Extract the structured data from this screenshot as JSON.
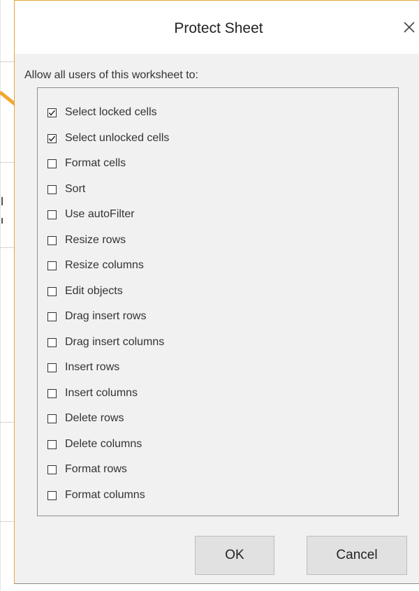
{
  "dialog": {
    "title": "Protect Sheet",
    "close_icon": "close-icon",
    "prompt": "Allow all users of this worksheet to:",
    "options": [
      {
        "label": "Select locked cells",
        "checked": true
      },
      {
        "label": "Select unlocked cells",
        "checked": true
      },
      {
        "label": "Format cells",
        "checked": false
      },
      {
        "label": "Sort",
        "checked": false
      },
      {
        "label": "Use autoFilter",
        "checked": false
      },
      {
        "label": "Resize rows",
        "checked": false
      },
      {
        "label": "Resize columns",
        "checked": false
      },
      {
        "label": "Edit objects",
        "checked": false
      },
      {
        "label": "Drag insert rows",
        "checked": false
      },
      {
        "label": "Drag insert columns",
        "checked": false
      },
      {
        "label": "Insert rows",
        "checked": false
      },
      {
        "label": "Insert columns",
        "checked": false
      },
      {
        "label": "Delete rows",
        "checked": false
      },
      {
        "label": "Delete columns",
        "checked": false
      },
      {
        "label": "Format rows",
        "checked": false
      },
      {
        "label": "Format columns",
        "checked": false
      }
    ],
    "ok_label": "OK",
    "cancel_label": "Cancel"
  },
  "colors": {
    "dialog_bg": "#f1f1f1",
    "title_bg": "#ffffff",
    "accent_border": "#e5a73a",
    "callout_arrow": "#f0a830",
    "button_bg": "#e1e1e1"
  }
}
